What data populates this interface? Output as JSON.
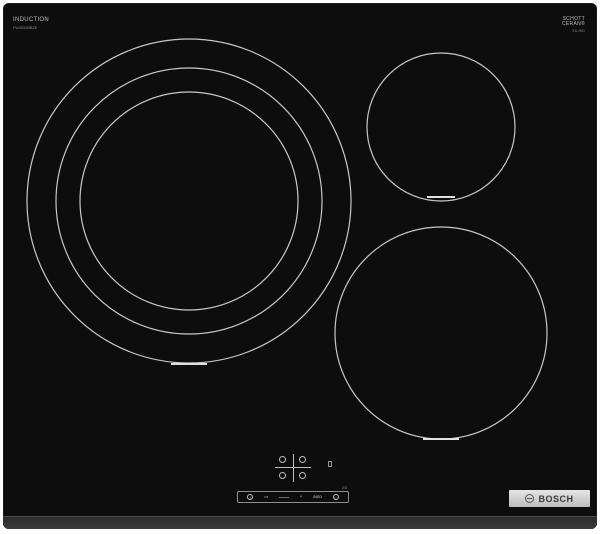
{
  "hob": {
    "print_top_left": {
      "line1": "INDUCTION",
      "line2": "PUJ631BB2E"
    },
    "print_top_right": {
      "line1": "SCHOTT",
      "line2": "CERAN®",
      "line3": "EU-H01"
    },
    "control_strip": {
      "tag": "2/3",
      "items": [
        "I",
        "▭",
        "+",
        "auto",
        "○"
      ]
    },
    "brand": "BOSCH",
    "colors": {
      "glass": "#0d0d0d",
      "ring": "#c8c8c8",
      "badge": "#d3d3d3"
    }
  }
}
